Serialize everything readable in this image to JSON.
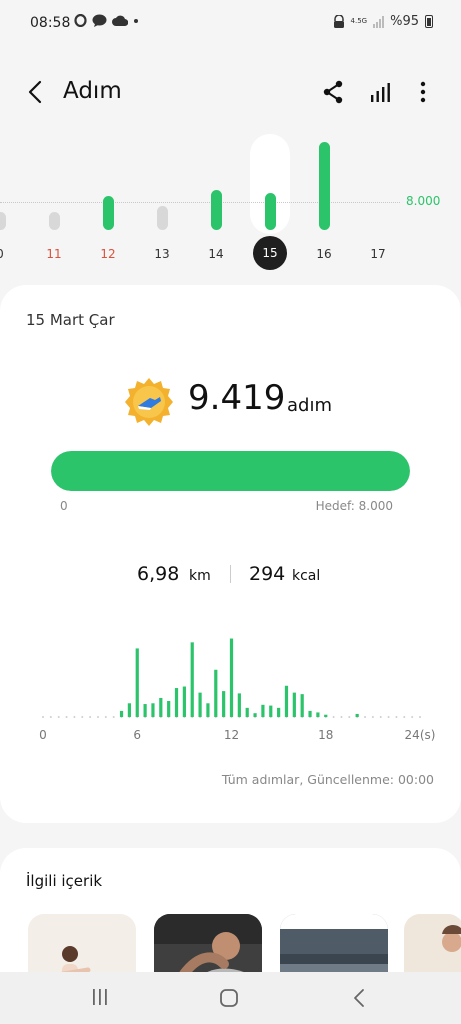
{
  "status_bar": {
    "time": "08:58",
    "network": "4.5G",
    "battery": "%95",
    "left_icons": [
      "opera-icon",
      "chat-icon",
      "cloud-icon",
      "dot-icon"
    ],
    "right_icons": [
      "lock-icon",
      "signal-icon",
      "battery-icon"
    ]
  },
  "header": {
    "title": "Adım",
    "back_icon": "chevron-left-icon",
    "share_icon": "share-icon",
    "chart_icon": "bar-chart-icon",
    "more_icon": "more-vertical-icon"
  },
  "week_chart": {
    "goal_label": "8.000",
    "goal_value": 8000,
    "days": [
      {
        "label": "0",
        "value": 2000,
        "goal_met": false,
        "red": false
      },
      {
        "label": "11",
        "value": 2000,
        "goal_met": false,
        "red": true
      },
      {
        "label": "12",
        "value": 3800,
        "goal_met": true,
        "red": true
      },
      {
        "label": "13",
        "value": 2700,
        "goal_met": false,
        "red": false
      },
      {
        "label": "14",
        "value": 4500,
        "goal_met": true,
        "red": false
      },
      {
        "label": "15",
        "value": 4100,
        "goal_met": true,
        "red": false,
        "selected": true
      },
      {
        "label": "16",
        "value": 9800,
        "goal_met": true,
        "red": false
      },
      {
        "label": "17",
        "value": 0,
        "goal_met": false,
        "red": false
      }
    ],
    "colors": {
      "goal_met": "#2cc46b",
      "below_goal": "#d8d8d8"
    }
  },
  "summary": {
    "date": "15 Mart Çar",
    "medal_icon": "achievement-medal-icon",
    "steps": "9.419",
    "unit": "adım",
    "progress": 1.0,
    "progress_min": "0",
    "goal_text": "Hedef: 8.000",
    "distance": "6,98",
    "distance_unit": "km",
    "calories": "294",
    "calories_unit": "kcal",
    "updated_text": "Tüm adımlar, Güncellenme: 00:00"
  },
  "chart_data": {
    "type": "bar",
    "x_tick_labels": [
      "0",
      "6",
      "12",
      "18",
      "24(s)"
    ],
    "x_ticks": [
      0,
      6,
      12,
      18,
      24
    ],
    "xlim": [
      0,
      24
    ],
    "bar_color": "#2cc46b",
    "bars": [
      {
        "x": 5.0,
        "v": 8
      },
      {
        "x": 5.5,
        "v": 18
      },
      {
        "x": 6.0,
        "v": 90
      },
      {
        "x": 6.5,
        "v": 17
      },
      {
        "x": 7.0,
        "v": 18
      },
      {
        "x": 7.5,
        "v": 25
      },
      {
        "x": 8.0,
        "v": 21
      },
      {
        "x": 8.5,
        "v": 38
      },
      {
        "x": 9.0,
        "v": 40
      },
      {
        "x": 9.5,
        "v": 98
      },
      {
        "x": 10.0,
        "v": 32
      },
      {
        "x": 10.5,
        "v": 18
      },
      {
        "x": 11.0,
        "v": 62
      },
      {
        "x": 11.5,
        "v": 34
      },
      {
        "x": 12.0,
        "v": 103
      },
      {
        "x": 12.5,
        "v": 31
      },
      {
        "x": 13.0,
        "v": 12
      },
      {
        "x": 13.5,
        "v": 5
      },
      {
        "x": 14.0,
        "v": 16
      },
      {
        "x": 14.5,
        "v": 15
      },
      {
        "x": 15.0,
        "v": 12
      },
      {
        "x": 15.5,
        "v": 41
      },
      {
        "x": 16.0,
        "v": 32
      },
      {
        "x": 16.5,
        "v": 30
      },
      {
        "x": 17.0,
        "v": 8
      },
      {
        "x": 17.5,
        "v": 6
      },
      {
        "x": 18.0,
        "v": 3
      },
      {
        "x": 20.0,
        "v": 4
      }
    ]
  },
  "related": {
    "title": "İlgili içerik"
  },
  "nav": {
    "recent_icon": "recent-apps-icon",
    "home_icon": "home-icon",
    "back_icon": "back-icon"
  }
}
